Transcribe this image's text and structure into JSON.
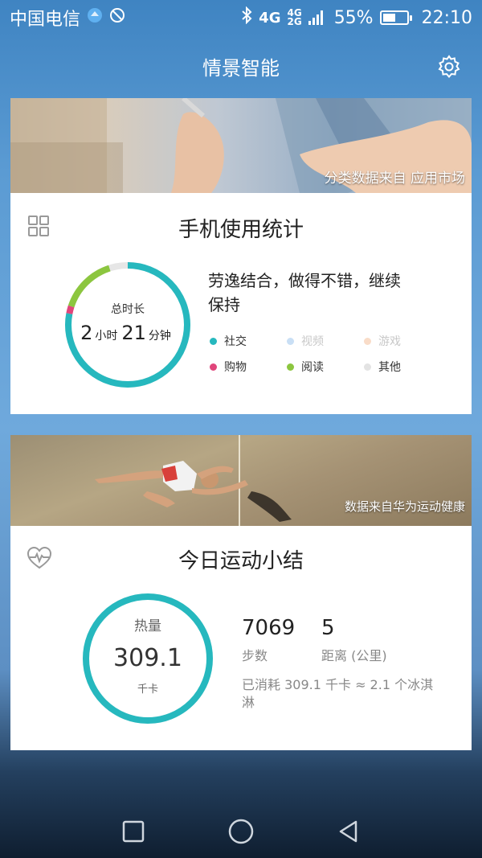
{
  "status_bar": {
    "carrier": "中国电信",
    "network_top": "4G",
    "network_small_top": "4G",
    "network_small_bottom": "2G",
    "battery_percent_text": "55%",
    "battery_level": 0.55,
    "time": "22:10"
  },
  "header": {
    "title": "情景智能"
  },
  "usage_card": {
    "banner_caption": "分类数据来自 应用市场",
    "title": "手机使用统计",
    "ring": {
      "label": "总时长",
      "hours": "2",
      "hours_unit": "小时",
      "minutes": "21",
      "minutes_unit": "分钟",
      "segments": [
        {
          "category": "社交",
          "fraction": 0.78,
          "color": "#26b8be"
        },
        {
          "category": "购物",
          "fraction": 0.02,
          "color": "#e0457b"
        },
        {
          "category": "阅读",
          "fraction": 0.15,
          "color": "#8cc63f"
        }
      ],
      "track_color": "#e6e6e6"
    },
    "comment": "劳逸结合，做得不错，继续保持",
    "legend": [
      {
        "label": "社交",
        "color": "#26b8be",
        "active": true
      },
      {
        "label": "视频",
        "color": "#c9dff5",
        "active": false
      },
      {
        "label": "游戏",
        "color": "#f9dcc8",
        "active": false
      },
      {
        "label": "购物",
        "color": "#e0457b",
        "active": true
      },
      {
        "label": "阅读",
        "color": "#8cc63f",
        "active": true
      },
      {
        "label": "其他",
        "color": "#e3e3e3",
        "active": true
      }
    ]
  },
  "sport_card": {
    "banner_caption": "数据来自华为运动健康",
    "title": "今日运动小结",
    "calories": {
      "label": "热量",
      "value": "309.1",
      "unit": "千卡",
      "color": "#26b8be"
    },
    "steps": {
      "value": "7069",
      "label": "步数"
    },
    "distance": {
      "value": "5",
      "label": "距离 (公里)"
    },
    "note": "已消耗 309.1 千卡 ≈ 2.1 个冰淇淋"
  },
  "navbar": {
    "icons": [
      "recent-apps-icon",
      "home-icon",
      "back-icon"
    ]
  }
}
